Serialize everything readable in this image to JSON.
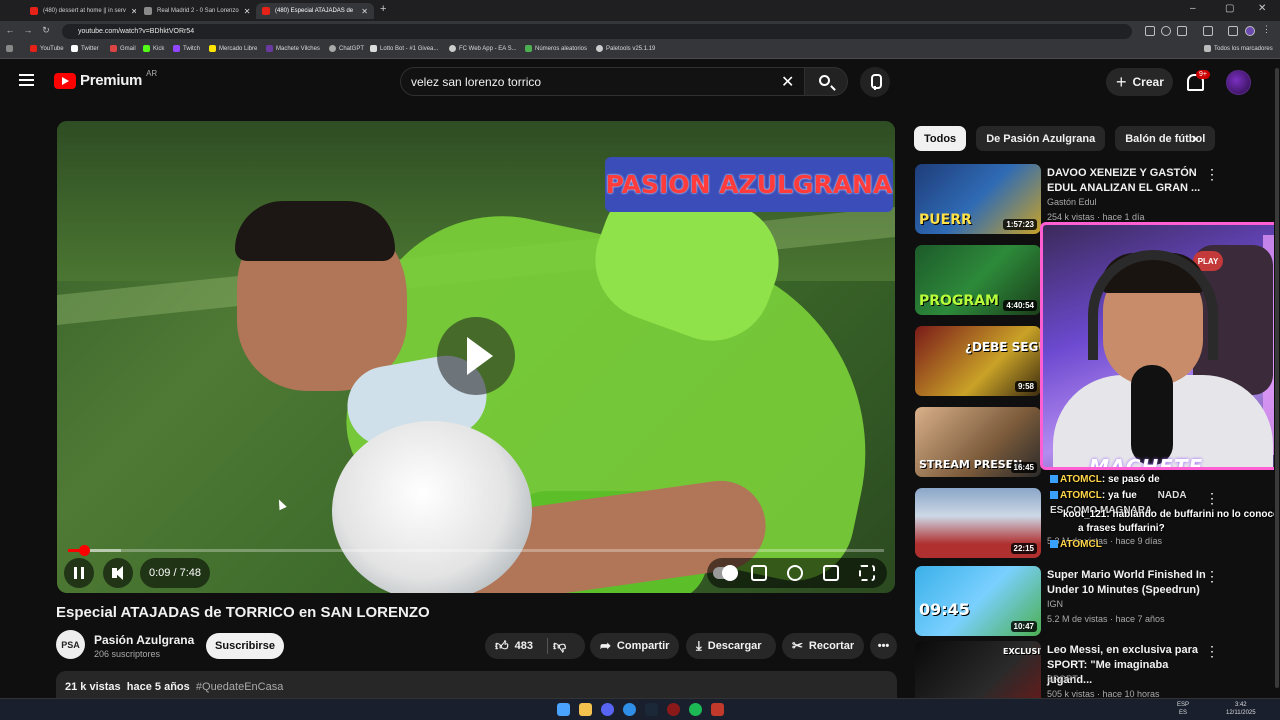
{
  "browser": {
    "tabs": [
      {
        "title": "(480) dessert at home || in serv"
      },
      {
        "title": "Real Madrid 2 - 0 San Lorenzo"
      },
      {
        "title": "(480) Especial ATAJADAS de"
      }
    ],
    "url": "youtube.com/watch?v=BDhktVORr54",
    "bookmarks": [
      "YouTube",
      "Twitter",
      "Gmail",
      "Kick",
      "Twitch",
      "Mercado Libre",
      "Machete Vilches",
      "ChatGPT",
      "Lotto Bot - #1 Givea...",
      "FC Web App - EA S...",
      "Números aleatorios",
      "Paletools v25.1.19"
    ],
    "all_bookmarks_label": "Todos los marcadores"
  },
  "header": {
    "logo_text": "Premium",
    "country_code": "AR",
    "search_value": "velez san lorenzo torrico",
    "create_label": "Crear",
    "notif_count": "9+"
  },
  "player": {
    "overlay_text": "PASION AZULGRANA",
    "time_current": "0:09",
    "time_total": "7:48",
    "progress_fraction": 0.019,
    "buffer_fraction": 0.065
  },
  "video": {
    "title": "Especial ATAJADAS de TORRICO en SAN LORENZO",
    "channel": "Pasión Azulgrana",
    "channel_logo_text": "PSA",
    "subscribers": "206 suscriptores",
    "subscribe_label": "Suscribirse",
    "likes": "483",
    "share_label": "Compartir",
    "download_label": "Descargar",
    "clip_label": "Recortar",
    "views": "21 k vistas",
    "age": "hace 5 años",
    "hashtag": "#QuedateEnCasa"
  },
  "chips": [
    "Todos",
    "De Pasión Azulgrana",
    "Balón de fútbol"
  ],
  "recommendations": [
    {
      "title": "DAVOO XENEIZE Y GASTÓN EDUL ANALIZAN EL GRAN ...",
      "channel": "Gastón Edul",
      "meta": "254 k vistas · hace 1 día",
      "duration": "1:57:23",
      "thumb_text": "PUERR",
      "thumb_color": "#2f6bb5"
    },
    {
      "title": "",
      "channel": "",
      "meta": "",
      "duration": "4:40:54",
      "thumb_text": "PROGRAM",
      "thumb_color": "#2d8a3a"
    },
    {
      "title": "",
      "channel": "",
      "meta": "",
      "duration": "9:58",
      "thumb_text": "¿DEBE SEGUIR?",
      "thumb_color": "#c9a227"
    },
    {
      "title": "",
      "channel": "",
      "meta": "",
      "duration": "16:45",
      "thumb_text": "STREAM PRESEN",
      "thumb_color": "#7a5a3a"
    },
    {
      "title": "",
      "channel": "",
      "meta": "5.3 M de vistas · hace 9 días",
      "duration": "22:15",
      "thumb_text": "",
      "thumb_color": "#8aa6c8"
    },
    {
      "title": "Super Mario World Finished In Under 10 Minutes (Speedrun)",
      "channel": "IGN",
      "meta": "5.2 M de vistas · hace 7 años",
      "duration": "10:47",
      "thumb_text": "09:45",
      "thumb_color": "#3ab0e8"
    },
    {
      "title": "Leo Messi, en exclusiva para SPORT: \"Me imaginaba jugand...",
      "channel": "SPORT",
      "meta": "505 k vistas · hace 10 horas",
      "duration": "",
      "thumb_text": "EXCLUSIVA",
      "thumb_color": "#1a1a1a"
    }
  ],
  "webcam": {
    "brand_text": "MACHETE",
    "logo_text": "PLAY"
  },
  "chat": [
    {
      "user": "ATOMCL",
      "text": ": se pasó de"
    },
    {
      "user": "ATOMCL",
      "text": ": ya fue"
    },
    {
      "user": "",
      "text": "NADA"
    },
    {
      "user": "",
      "text": "ES COMO MAGNARA"
    },
    {
      "user": "koot_121",
      "text": ": hablando de buffarini no lo conoces"
    },
    {
      "user": "",
      "text": "a frases buffarini?"
    },
    {
      "user": "ATOMCL",
      "text": ""
    }
  ],
  "taskbar": {
    "lang": "ESP",
    "region": "ES",
    "time": "3:42",
    "date": "12/11/2025"
  },
  "colors": {
    "youtube_red": "#ff0000",
    "background": "#0f0f0f",
    "chip_bg": "#272727"
  }
}
